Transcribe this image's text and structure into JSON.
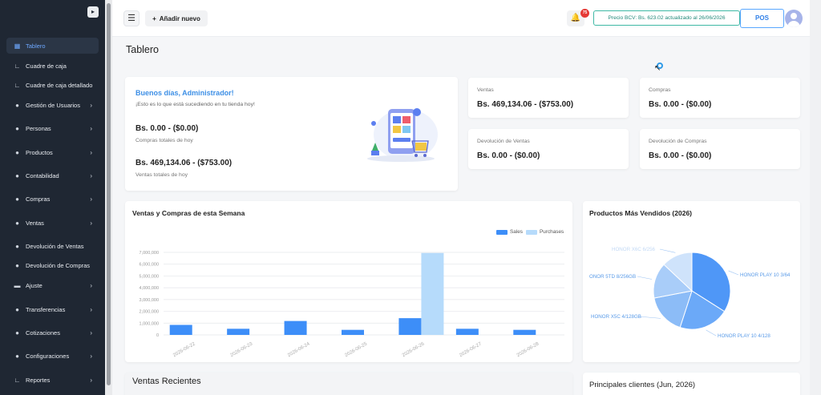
{
  "sidebar": {
    "items": [
      {
        "label": "Tablero",
        "icon": "dashboard-icon",
        "glyph": "▦",
        "active": true,
        "chevron": false
      },
      {
        "label": "Cuadre de caja",
        "icon": "chart-axis-icon",
        "glyph": "∟",
        "chevron": false
      },
      {
        "label": "Cuadre de caja detallado",
        "icon": "chart-axis-icon",
        "glyph": "∟",
        "chevron": false
      },
      {
        "label": "Gestión de Usuarios",
        "icon": "user-gear-icon",
        "glyph": "●",
        "chevron": true
      },
      {
        "label": "Personas",
        "icon": "person-icon",
        "glyph": "●",
        "chevron": true
      },
      {
        "label": "Productos",
        "icon": "box-icon",
        "glyph": "●",
        "chevron": true
      },
      {
        "label": "Contabilidad",
        "icon": "accounting-icon",
        "glyph": "●",
        "chevron": true
      },
      {
        "label": "Compras",
        "icon": "purchase-icon",
        "glyph": "●",
        "chevron": true
      },
      {
        "label": "Ventas",
        "icon": "cart-icon",
        "glyph": "●",
        "chevron": true
      },
      {
        "label": "Devolución de Ventas",
        "icon": "return-icon",
        "glyph": "●",
        "chevron": false
      },
      {
        "label": "Devolución de Compras",
        "icon": "return-icon",
        "glyph": "●",
        "chevron": false
      },
      {
        "label": "Ajuste",
        "icon": "adjust-icon",
        "glyph": "▬",
        "chevron": true
      },
      {
        "label": "Transferencias",
        "icon": "transfer-icon",
        "glyph": "●",
        "chevron": true
      },
      {
        "label": "Cotizaciones",
        "icon": "quote-icon",
        "glyph": "●",
        "chevron": true
      },
      {
        "label": "Configuraciones",
        "icon": "settings-icon",
        "glyph": "●",
        "chevron": true
      },
      {
        "label": "Reportes",
        "icon": "report-icon",
        "glyph": "∟",
        "chevron": true
      }
    ]
  },
  "topbar": {
    "add_label": "Añadir nuevo",
    "notification_count": "75",
    "bcv_text": "Precio BCV: Bs. 623.02 actualizado al 26/06/2026",
    "pos_label": "POS"
  },
  "page": {
    "title": "Tablero"
  },
  "welcome": {
    "greeting": "Buenos días, Administrador!",
    "subtitle": "¡Esto es lo que está sucediendo en tu tienda hoy!",
    "purchases_value": "Bs. 0.00 - ($0.00)",
    "purchases_label": "Compras totales de hoy",
    "sales_value": "Bs. 469,134.06 - ($753.00)",
    "sales_label": "Ventas totales de hoy"
  },
  "stats": [
    {
      "label": "Ventas",
      "value": "Bs. 469,134.06 - ($753.00)"
    },
    {
      "label": "Compras",
      "value": "Bs. 0.00 - ($0.00)"
    },
    {
      "label": "Devolución de Ventas",
      "value": "Bs. 0.00 - ($0.00)"
    },
    {
      "label": "Devolución de Compras",
      "value": "Bs. 0.00 - ($0.00)"
    }
  ],
  "weekly_chart": {
    "title": "Ventas y Compras de esta Semana",
    "legend_sales": "Sales",
    "legend_purchases": "Purchases"
  },
  "pie_chart": {
    "title": "Productos Más Vendidos (2026)"
  },
  "recent": {
    "title": "Ventas Recientes"
  },
  "clients": {
    "title": "Principales clientes (Jun, 2026)"
  },
  "colors": {
    "sales": "#3d8ef8",
    "purchases": "#b6dbfb",
    "sidebar": "#1f2733",
    "accent": "#3d8fe6"
  },
  "chart_data": [
    {
      "type": "bar",
      "title": "Ventas y Compras de esta Semana",
      "categories": [
        "2026-06-22",
        "2026-06-23",
        "2026-06-24",
        "2026-06-25",
        "2026-06-26",
        "2026-06-27",
        "2026-06-28"
      ],
      "series": [
        {
          "name": "Sales",
          "values": [
            850000,
            520000,
            1180000,
            430000,
            1420000,
            520000,
            430000
          ]
        },
        {
          "name": "Purchases",
          "values": [
            0,
            0,
            0,
            0,
            6950000,
            0,
            0
          ]
        }
      ],
      "yticks": [
        "0",
        "1,000,000",
        "2,000,000",
        "3,000,000",
        "4,000,000",
        "5,000,000",
        "6,000,000",
        "7,000,000"
      ],
      "ylim": [
        0,
        7000000
      ],
      "legend": "top-right",
      "grid": true
    },
    {
      "type": "pie",
      "title": "Productos Más Vendidos (2026)",
      "labels": [
        "HONOR PLAY 10 3/64",
        "HONOR PLAY 10 4/128",
        "HONOR X5C 4/128GB",
        "ONOR 5TD 8/256GB",
        "HONOR X6C 6/256"
      ],
      "values": [
        34,
        21,
        17,
        15,
        13
      ],
      "colors": [
        "#4f97f7",
        "#6ba9f8",
        "#8cbcf7",
        "#a9cdf9",
        "#cfe3fb"
      ]
    }
  ]
}
